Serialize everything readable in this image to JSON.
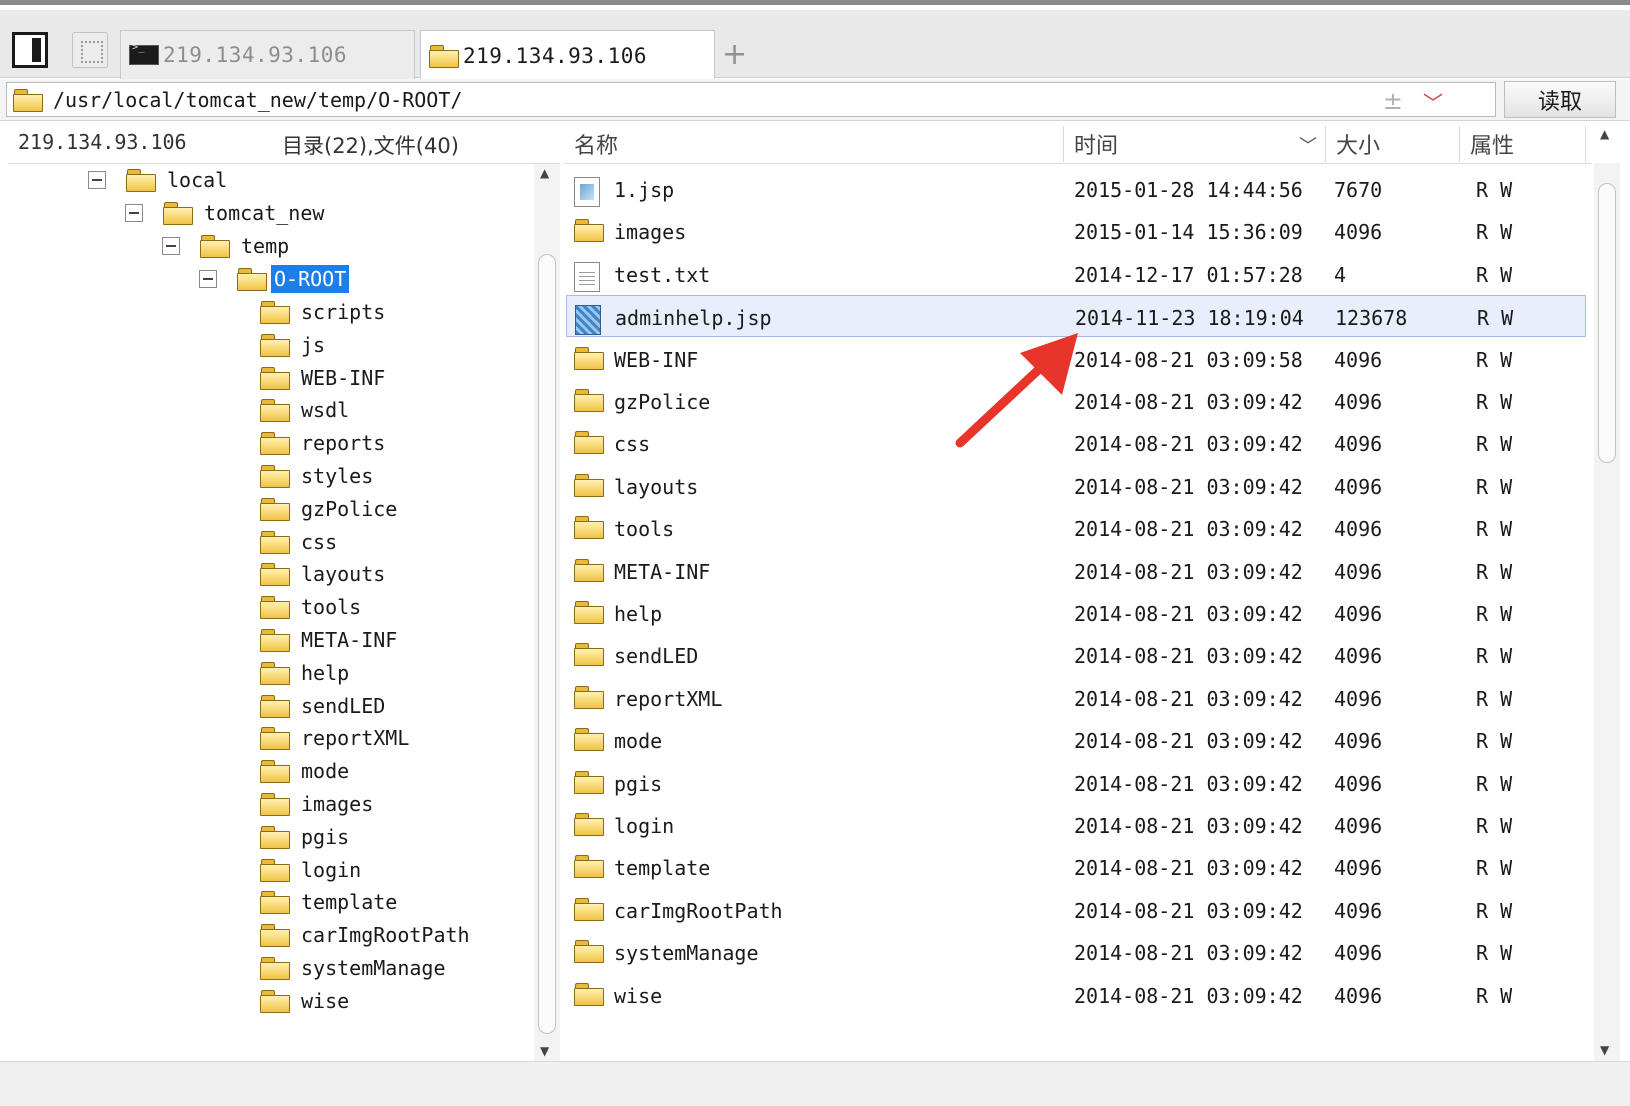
{
  "tabs": [
    {
      "label": "219.134.93.106",
      "icon": "terminal-icon",
      "active": false
    },
    {
      "label": "219.134.93.106",
      "icon": "folder-icon",
      "active": true
    }
  ],
  "path_bar": {
    "path": "/usr/local/tomcat_new/temp/O-ROOT/",
    "plus_glyph": "±",
    "read_button": "读取"
  },
  "tree_header": {
    "host": "219.134.93.106",
    "counts": "目录(22),文件(40)"
  },
  "columns": {
    "name": "名称",
    "time": "时间",
    "size": "大小",
    "attr": "属性"
  },
  "tree": {
    "ancestors": [
      "local",
      "tomcat_new",
      "temp",
      "O-ROOT"
    ],
    "children": [
      "scripts",
      "js",
      "WEB-INF",
      "wsdl",
      "reports",
      "styles",
      "gzPolice",
      "css",
      "layouts",
      "tools",
      "META-INF",
      "help",
      "sendLED",
      "reportXML",
      "mode",
      "images",
      "pgis",
      "login",
      "template",
      "carImgRootPath",
      "systemManage",
      "wise"
    ]
  },
  "files": [
    {
      "name": "1.jsp",
      "time": "2015-01-28 14:44:56",
      "size": "7670",
      "attr": "R W",
      "kind": "jsp"
    },
    {
      "name": "images",
      "time": "2015-01-14 15:36:09",
      "size": "4096",
      "attr": "R W",
      "kind": "folder"
    },
    {
      "name": "test.txt",
      "time": "2014-12-17 01:57:28",
      "size": "4",
      "attr": "R W",
      "kind": "txt"
    },
    {
      "name": "adminhelp.jsp",
      "time": "2014-11-23 18:19:04",
      "size": "123678",
      "attr": "R W",
      "kind": "blue",
      "selected": true
    },
    {
      "name": "WEB-INF",
      "time": "2014-08-21 03:09:58",
      "size": "4096",
      "attr": "R W",
      "kind": "folder"
    },
    {
      "name": "gzPolice",
      "time": "2014-08-21 03:09:42",
      "size": "4096",
      "attr": "R W",
      "kind": "folder"
    },
    {
      "name": "css",
      "time": "2014-08-21 03:09:42",
      "size": "4096",
      "attr": "R W",
      "kind": "folder"
    },
    {
      "name": "layouts",
      "time": "2014-08-21 03:09:42",
      "size": "4096",
      "attr": "R W",
      "kind": "folder"
    },
    {
      "name": "tools",
      "time": "2014-08-21 03:09:42",
      "size": "4096",
      "attr": "R W",
      "kind": "folder"
    },
    {
      "name": "META-INF",
      "time": "2014-08-21 03:09:42",
      "size": "4096",
      "attr": "R W",
      "kind": "folder"
    },
    {
      "name": "help",
      "time": "2014-08-21 03:09:42",
      "size": "4096",
      "attr": "R W",
      "kind": "folder"
    },
    {
      "name": "sendLED",
      "time": "2014-08-21 03:09:42",
      "size": "4096",
      "attr": "R W",
      "kind": "folder"
    },
    {
      "name": "reportXML",
      "time": "2014-08-21 03:09:42",
      "size": "4096",
      "attr": "R W",
      "kind": "folder"
    },
    {
      "name": "mode",
      "time": "2014-08-21 03:09:42",
      "size": "4096",
      "attr": "R W",
      "kind": "folder"
    },
    {
      "name": "pgis",
      "time": "2014-08-21 03:09:42",
      "size": "4096",
      "attr": "R W",
      "kind": "folder"
    },
    {
      "name": "login",
      "time": "2014-08-21 03:09:42",
      "size": "4096",
      "attr": "R W",
      "kind": "folder"
    },
    {
      "name": "template",
      "time": "2014-08-21 03:09:42",
      "size": "4096",
      "attr": "R W",
      "kind": "folder"
    },
    {
      "name": "carImgRootPath",
      "time": "2014-08-21 03:09:42",
      "size": "4096",
      "attr": "R W",
      "kind": "folder"
    },
    {
      "name": "systemManage",
      "time": "2014-08-21 03:09:42",
      "size": "4096",
      "attr": "R W",
      "kind": "folder"
    },
    {
      "name": "wise",
      "time": "2014-08-21 03:09:42",
      "size": "4096",
      "attr": "R W",
      "kind": "folder"
    }
  ],
  "colors": {
    "selection": "#1e7ee8",
    "row_highlight": "#e9eefc",
    "annotation_arrow": "#e8352b",
    "folder": "#f0c445"
  }
}
